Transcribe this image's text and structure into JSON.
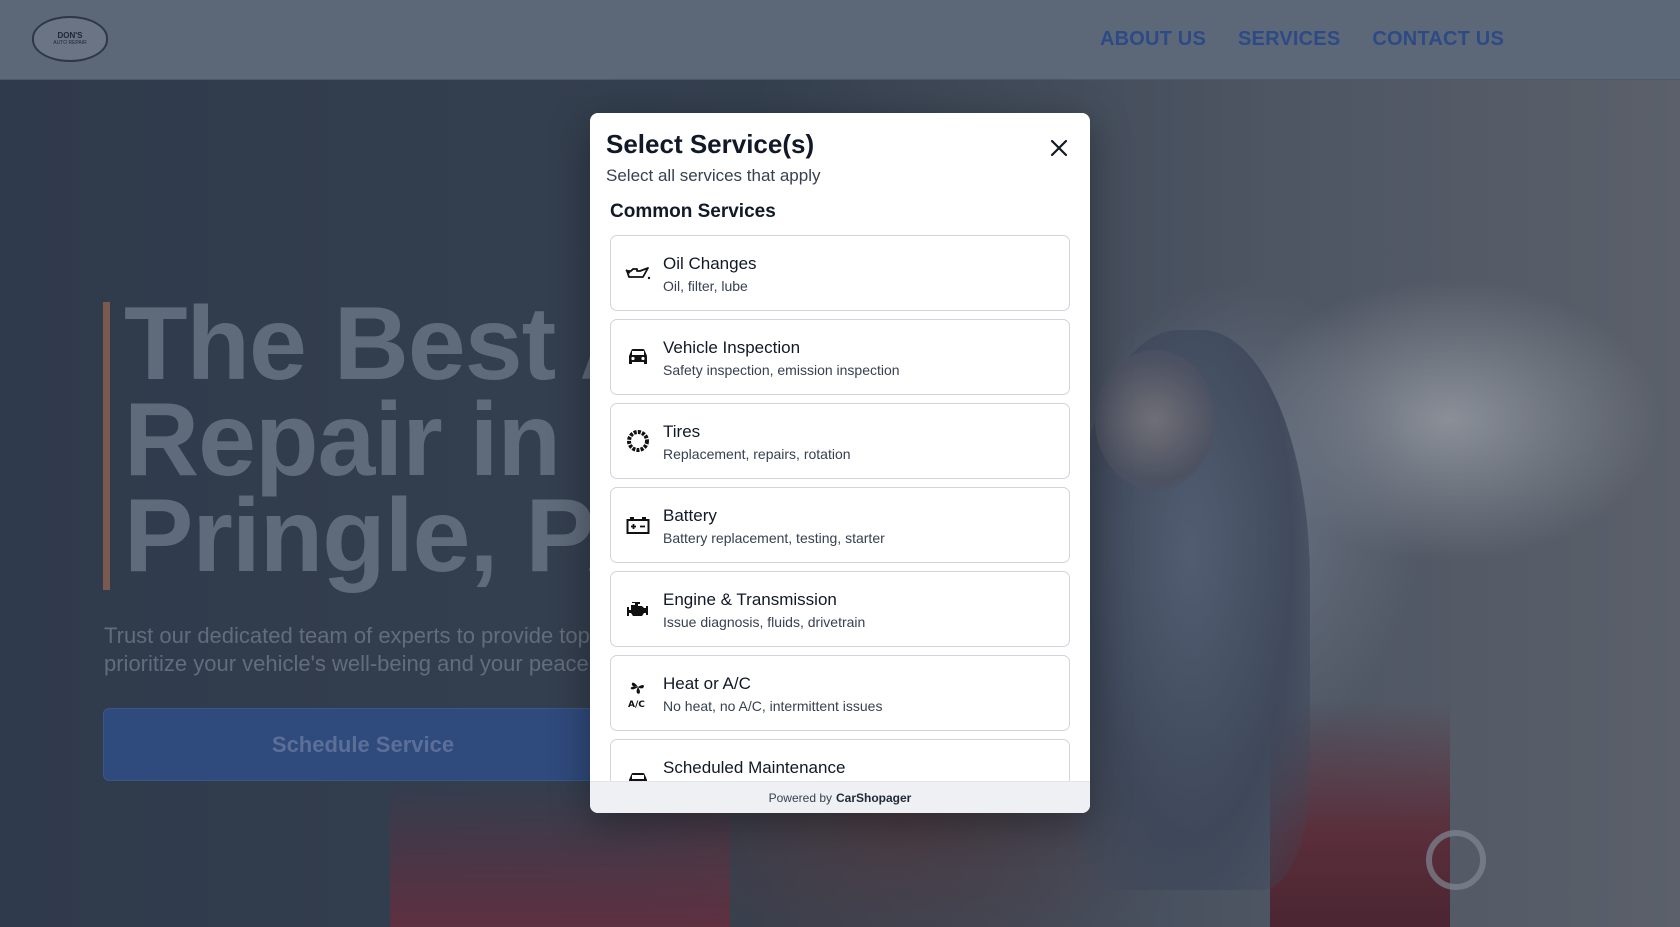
{
  "nav": {
    "logo_text": "DON'S",
    "logo_sub": "AUTO REPAIR",
    "items": [
      {
        "label": "ABOUT US"
      },
      {
        "label": "SERVICES"
      },
      {
        "label": "CONTACT US"
      }
    ]
  },
  "hero": {
    "title_lines": [
      "The Best Au",
      "Repair in",
      "Pringle, PA"
    ],
    "text_line1": "Trust our dedicated team of experts to provide top-notc",
    "text_line2": "prioritize your vehicle's well-being and your peace of mi",
    "cta_label": "Schedule Service"
  },
  "modal": {
    "title": "Select Service(s)",
    "subtitle": "Select all services that apply",
    "section_title": "Common Services",
    "services": [
      {
        "name": "Oil Changes",
        "desc": "Oil, filter, lube",
        "icon": "oil-can-icon"
      },
      {
        "name": "Vehicle Inspection",
        "desc": "Safety inspection, emission inspection",
        "icon": "car-icon"
      },
      {
        "name": "Tires",
        "desc": "Replacement, repairs, rotation",
        "icon": "tire-icon"
      },
      {
        "name": "Battery",
        "desc": "Battery replacement, testing, starter",
        "icon": "battery-icon"
      },
      {
        "name": "Engine & Transmission",
        "desc": "Issue diagnosis, fluids, drivetrain",
        "icon": "engine-icon"
      },
      {
        "name": "Heat or A/C",
        "desc": "No heat, no A/C, intermittent issues",
        "icon": "fan-ac-icon"
      },
      {
        "name": "Scheduled Maintenance",
        "desc": "",
        "icon": "car-icon"
      }
    ],
    "footer_prefix": "Powered by",
    "footer_brand": "CarShopager"
  }
}
